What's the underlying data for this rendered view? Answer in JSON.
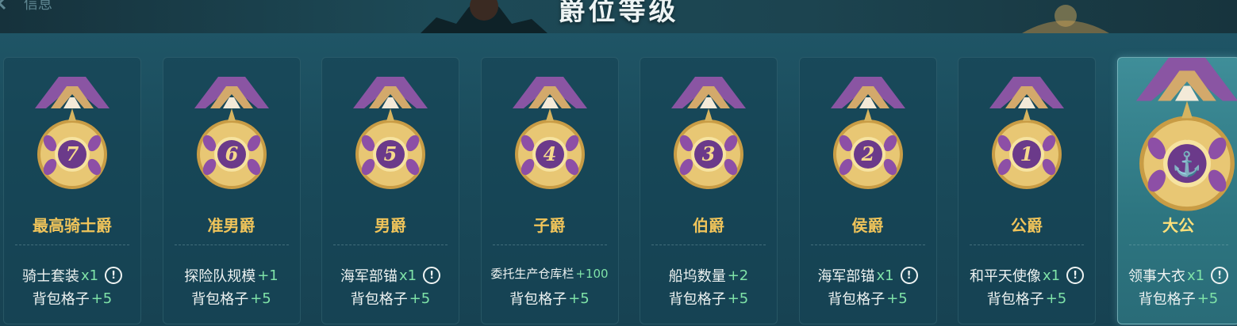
{
  "header": {
    "back_label": "信息",
    "title": "爵位等级"
  },
  "colors": {
    "rank_name": "#f0c45a",
    "bonus": "#7fe3a8",
    "ribbon_purple": "#8a55a3",
    "ribbon_gold": "#d3a96b"
  },
  "ranks": [
    {
      "name": "最高骑士爵",
      "numeral": "7",
      "reward1": "骑士套装",
      "reward1_value": "x1",
      "reward1_info": true,
      "reward2": "背包格子",
      "reward2_value": "+5",
      "active": false
    },
    {
      "name": "准男爵",
      "numeral": "6",
      "reward1": "探险队规模",
      "reward1_value": "+1",
      "reward1_info": false,
      "reward2": "背包格子",
      "reward2_value": "+5",
      "active": false
    },
    {
      "name": "男爵",
      "numeral": "5",
      "reward1": "海军部锚",
      "reward1_value": "x1",
      "reward1_info": true,
      "reward2": "背包格子",
      "reward2_value": "+5",
      "active": false
    },
    {
      "name": "子爵",
      "numeral": "4",
      "reward1": "委托生产仓库栏",
      "reward1_value": "+100",
      "reward1_info": false,
      "reward2": "背包格子",
      "reward2_value": "+5",
      "active": false
    },
    {
      "name": "伯爵",
      "numeral": "3",
      "reward1": "船坞数量",
      "reward1_value": "+2",
      "reward1_info": false,
      "reward2": "背包格子",
      "reward2_value": "+5",
      "active": false
    },
    {
      "name": "侯爵",
      "numeral": "2",
      "reward1": "海军部锚",
      "reward1_value": "x1",
      "reward1_info": true,
      "reward2": "背包格子",
      "reward2_value": "+5",
      "active": false
    },
    {
      "name": "公爵",
      "numeral": "1",
      "reward1": "和平天使像",
      "reward1_value": "x1",
      "reward1_info": true,
      "reward2": "背包格子",
      "reward2_value": "+5",
      "active": false
    },
    {
      "name": "大公",
      "numeral": "anchor",
      "reward1": "领事大衣",
      "reward1_value": "x1",
      "reward1_info": true,
      "reward2": "背包格子",
      "reward2_value": "+5",
      "active": true
    }
  ],
  "info_glyph": "!"
}
